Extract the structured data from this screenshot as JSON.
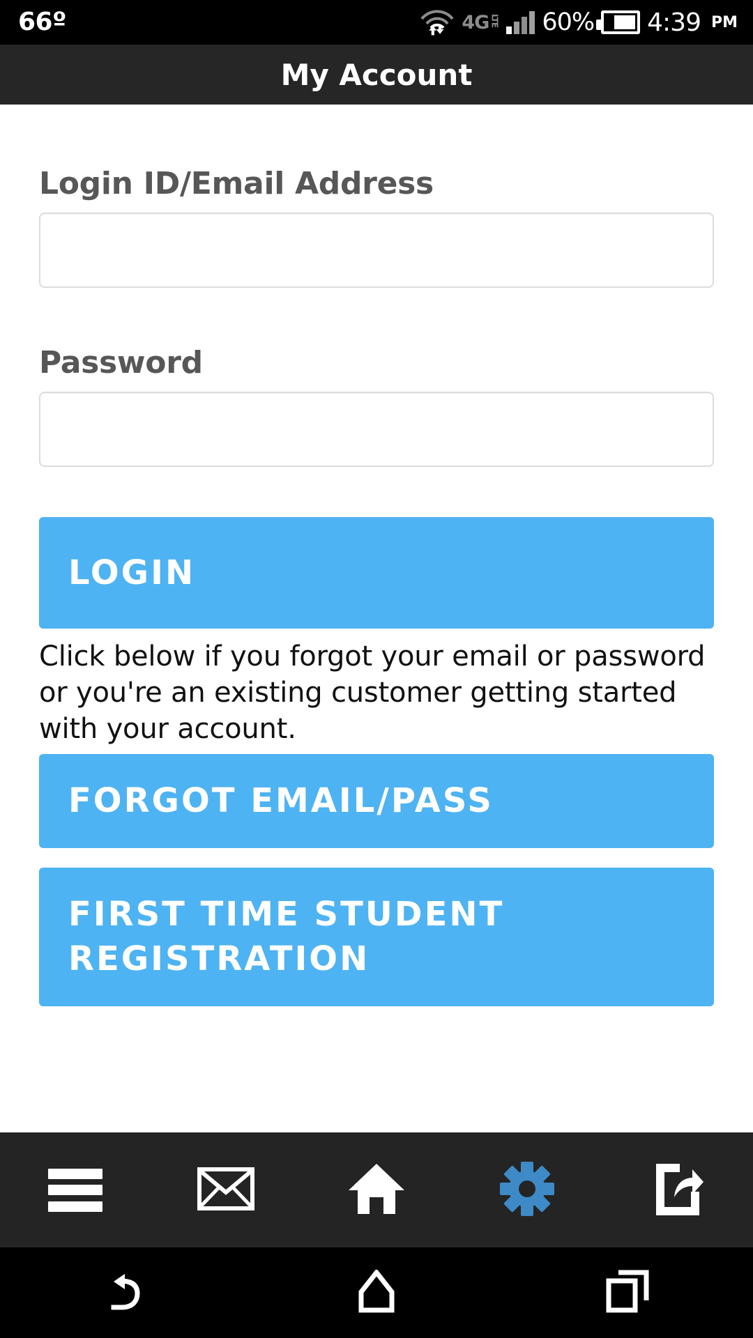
{
  "status_bar": {
    "temperature": "66º",
    "network_type": "4G",
    "network_suffix": "LTE",
    "battery_percent": "60%",
    "time": "4:39",
    "meridiem": "PM",
    "icons": [
      "wifi-icon",
      "data-transfer-icon",
      "signal-bars-icon",
      "battery-icon"
    ]
  },
  "header": {
    "title": "My Account"
  },
  "form": {
    "login": {
      "label": "Login ID/Email Address",
      "value": "",
      "placeholder": ""
    },
    "password": {
      "label": "Password",
      "value": "",
      "placeholder": ""
    },
    "login_button": "LOGIN",
    "helper_text": "Click below if you forgot your email or password or you're an existing customer getting started with your account.",
    "forgot_button": "FORGOT EMAIL/PASS",
    "register_button": "FIRST TIME STUDENT REGISTRATION"
  },
  "app_toolbar": {
    "items": [
      {
        "name": "menu",
        "icon": "hamburger-menu-icon",
        "active": false
      },
      {
        "name": "mail",
        "icon": "envelope-icon",
        "active": false
      },
      {
        "name": "home",
        "icon": "home-icon",
        "active": false
      },
      {
        "name": "settings",
        "icon": "gear-icon",
        "active": true
      },
      {
        "name": "share",
        "icon": "share-icon",
        "active": false
      }
    ]
  },
  "android_nav": {
    "items": [
      {
        "name": "back",
        "icon": "back-arrow-icon"
      },
      {
        "name": "home",
        "icon": "home-pentagon-icon"
      },
      {
        "name": "recents",
        "icon": "recent-apps-icon"
      }
    ]
  },
  "colors": {
    "accent_blue": "#4EB3F2",
    "toolbar_active_blue": "#3D8AC7",
    "titlebar_bg": "#262626",
    "toolbar_bg": "#242424",
    "label_gray": "#575757",
    "input_border": "#dcdcdc"
  }
}
